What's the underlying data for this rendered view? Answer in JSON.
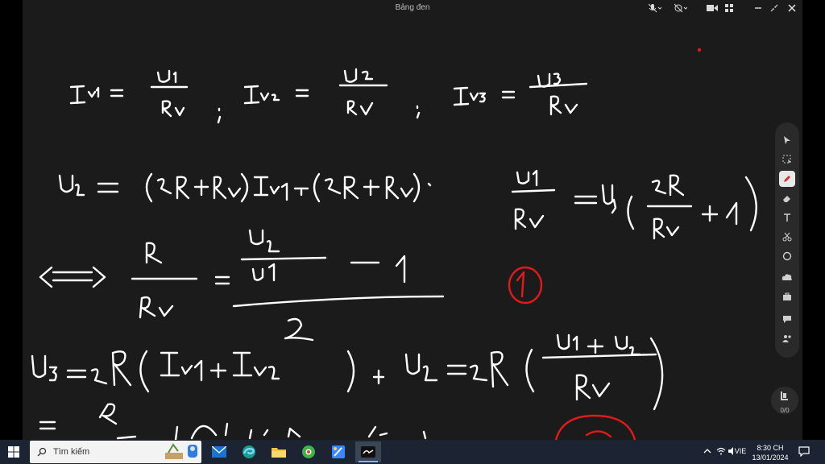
{
  "window": {
    "title": "Bảng đen"
  },
  "taskbar": {
    "search_placeholder": "Tìm kiếm",
    "language": "VIE",
    "time": "8:30 CH",
    "date": "13/01/2024"
  },
  "board": {
    "page_count": "0/0"
  },
  "colors": {
    "ink": "#ffffff",
    "highlight": "#e01b1b",
    "board": "#1b1b1b",
    "taskbar": "#1c2433"
  },
  "icons": {
    "titlebar": [
      "mic-off-icon",
      "camera-off-icon",
      "video-icon",
      "grid-icon",
      "minimize-icon",
      "restore-icon",
      "close-icon"
    ],
    "tools": [
      "pointer-icon",
      "select-icon",
      "pen-icon",
      "eraser-icon",
      "text-icon",
      "scissors-icon",
      "shape-icon",
      "cloud-icon",
      "toolbox-icon",
      "chat-icon",
      "people-icon"
    ]
  }
}
